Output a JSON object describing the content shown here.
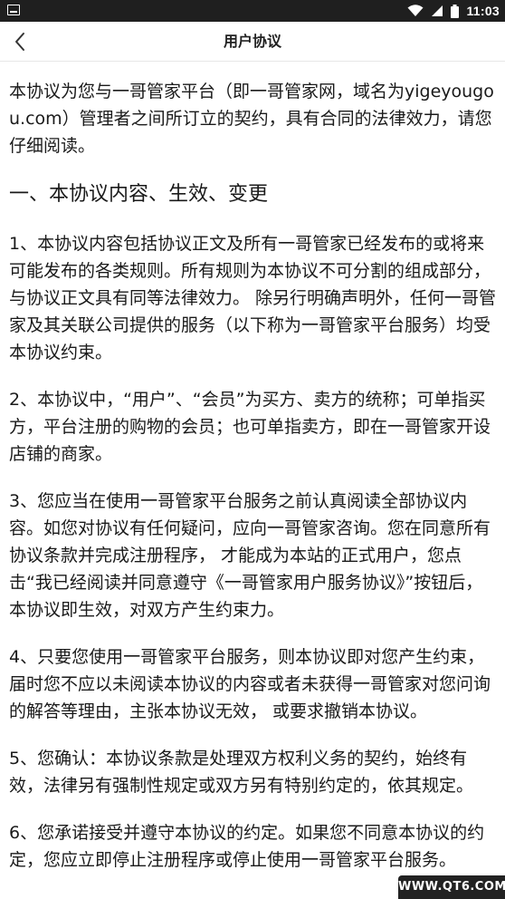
{
  "status_bar": {
    "time": "11:03",
    "icons": [
      "notification-icon",
      "wifi-icon",
      "cell-signal-icon",
      "battery-icon"
    ]
  },
  "nav": {
    "title": "用户协议",
    "back_icon": "chevron-left-icon"
  },
  "agreement": {
    "intro": "本协议为您与一哥管家平台（即一哥管家网，域名为yigeyougou.com）管理者之间所订立的契约，具有合同的法律效力，请您仔细阅读。",
    "section1_title": "一、本协议内容、生效、变更",
    "clauses": [
      "1、本协议内容包括协议正文及所有一哥管家已经发布的或将来可能发布的各类规则。所有规则为本协议不可分割的组成部分，与协议正文具有同等法律效力。 除另行明确声明外，任何一哥管家及其关联公司提供的服务（以下称为一哥管家平台服务）均受本协议约束。",
      "2、本协议中，“用户”、“会员”为买方、卖方的统称；可单指买方，平台注册的购物的会员；也可单指卖方，即在一哥管家开设店铺的商家。",
      "3、您应当在使用一哥管家平台服务之前认真阅读全部协议内容。如您对协议有任何疑问，应向一哥管家咨询。您在同意所有协议条款并完成注册程序， 才能成为本站的正式用户，您点击“我已经阅读并同意遵守《一哥管家用户服务协议》”按钮后，本协议即生效，对双方产生约束力。",
      "4、只要您使用一哥管家平台服务，则本协议即对您产生约束，届时您不应以未阅读本协议的内容或者未获得一哥管家对您问询的解答等理由，主张本协议无效， 或要求撤销本协议。",
      "5、您确认：本协议条款是处理双方权利义务的契约，始终有效，法律另有强制性规定或双方另有特别约定的，依其规定。",
      "6、您承诺接受并遵守本协议的约定。如果您不同意本协议的约定，您应立即停止注册程序或停止使用一哥管家平台服务。"
    ]
  },
  "watermark": "WWW.QT6.COM"
}
